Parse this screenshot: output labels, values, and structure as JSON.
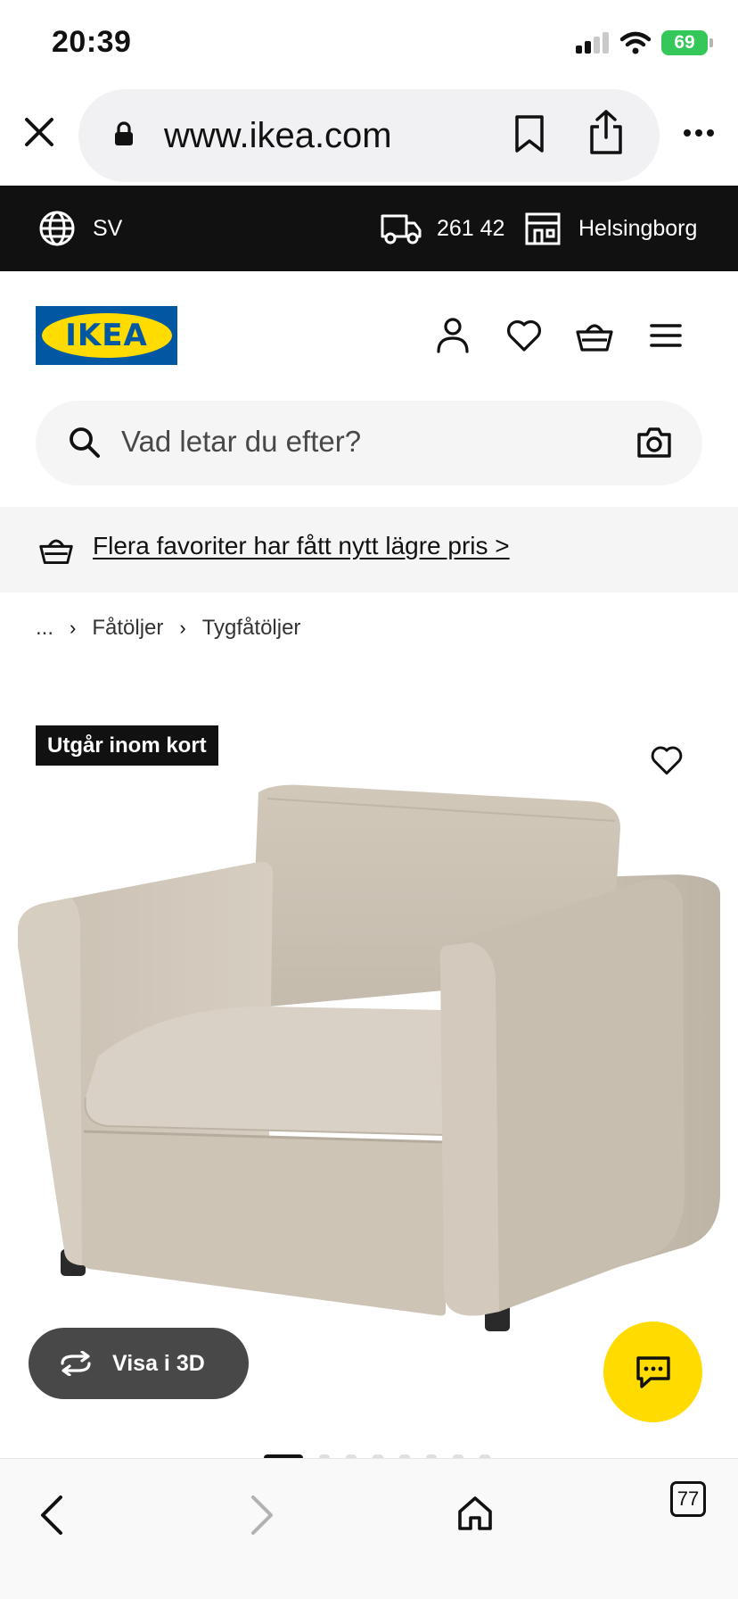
{
  "status_bar": {
    "time": "20:39",
    "battery": "69",
    "icons": [
      "signal-icon",
      "wifi-icon",
      "battery-icon"
    ]
  },
  "browser": {
    "url": "www.ikea.com",
    "icons": [
      "close-icon",
      "lock-icon",
      "bookmark-icon",
      "share-icon",
      "more-icon"
    ],
    "tabs_count": "77",
    "nav_icons": [
      "back-icon",
      "forward-icon",
      "home-icon",
      "tabs-icon"
    ]
  },
  "utility_bar": {
    "language": "SV",
    "postal_code": "261 42",
    "store": "Helsingborg"
  },
  "header": {
    "logo_text": "IKEA",
    "icons": [
      "user-icon",
      "heart-icon",
      "basket-icon",
      "menu-icon"
    ]
  },
  "search": {
    "placeholder": "Vad letar du efter?"
  },
  "promo": {
    "text": "Flera favoriter har fått nytt lägre pris >"
  },
  "breadcrumb": {
    "ellipsis": "...",
    "items": [
      "Fåtöljer",
      "Tygfåtöljer"
    ]
  },
  "product": {
    "badge": "Utgår inom kort",
    "view_3d_label": "Visa i 3D",
    "carousel": {
      "count": 8,
      "active": 0
    }
  },
  "colors": {
    "ikea_blue": "#0058a3",
    "ikea_yellow": "#ffdb00",
    "utility_bar": "#111111",
    "fabric": "#cfc6b8",
    "battery_green": "#34c759"
  }
}
